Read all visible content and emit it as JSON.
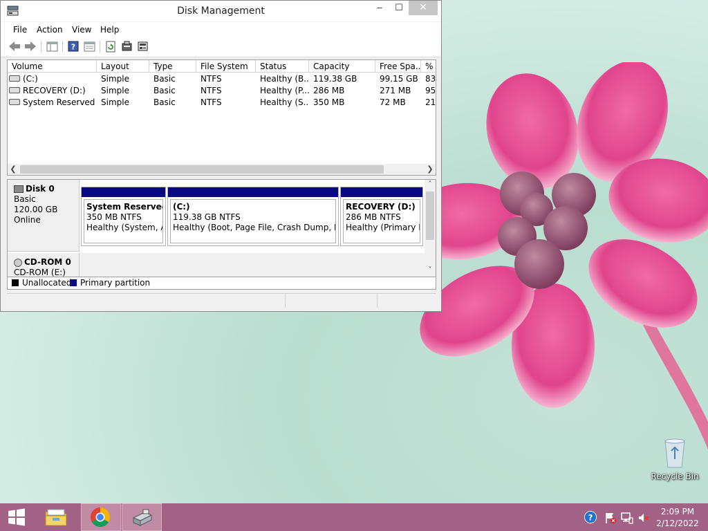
{
  "window": {
    "title": "Disk Management",
    "controls": {
      "minimize": "‒",
      "maximize": "☐",
      "close": "✕"
    }
  },
  "menu": [
    "File",
    "Action",
    "View",
    "Help"
  ],
  "volume_list": {
    "columns": [
      "Volume",
      "Layout",
      "Type",
      "File System",
      "Status",
      "Capacity",
      "Free Spa...",
      "% F"
    ],
    "rows": [
      [
        "(C:)",
        "Simple",
        "Basic",
        "NTFS",
        "Healthy (B...",
        "119.38 GB",
        "99.15 GB",
        "83"
      ],
      [
        "RECOVERY (D:)",
        "Simple",
        "Basic",
        "NTFS",
        "Healthy (P...",
        "286 MB",
        "271 MB",
        "95"
      ],
      [
        "System Reserved",
        "Simple",
        "Basic",
        "NTFS",
        "Healthy (S...",
        "350 MB",
        "72 MB",
        "21"
      ]
    ]
  },
  "disk0": {
    "name": "Disk 0",
    "type": "Basic",
    "size": "120.00 GB",
    "state": "Online",
    "partitions": [
      {
        "title": "System Reserved",
        "size": "350 MB NTFS",
        "status": "Healthy (System, Act"
      },
      {
        "title": "(C:)",
        "size": "119.38 GB NTFS",
        "status": "Healthy (Boot, Page File, Crash Dump, Prima"
      },
      {
        "title": "RECOVERY  (D:)",
        "size": "286 MB NTFS",
        "status": "Healthy (Primary Pa"
      }
    ]
  },
  "cdrom0": {
    "name": "CD-ROM 0",
    "drive": "CD-ROM (E:)"
  },
  "legend": {
    "unallocated": "Unallocated",
    "primary": "Primary partition"
  },
  "colors": {
    "primary_partition": "#0a0a80",
    "unallocated": "#000000",
    "taskbar": "#a16286"
  },
  "desktop": {
    "recycle_bin": "Recycle Bin"
  },
  "taskbar": {
    "items": [
      "start-icon",
      "file-explorer-icon",
      "chrome-icon",
      "disk-management-icon"
    ],
    "time": "2:09 PM",
    "date": "2/12/2022"
  }
}
